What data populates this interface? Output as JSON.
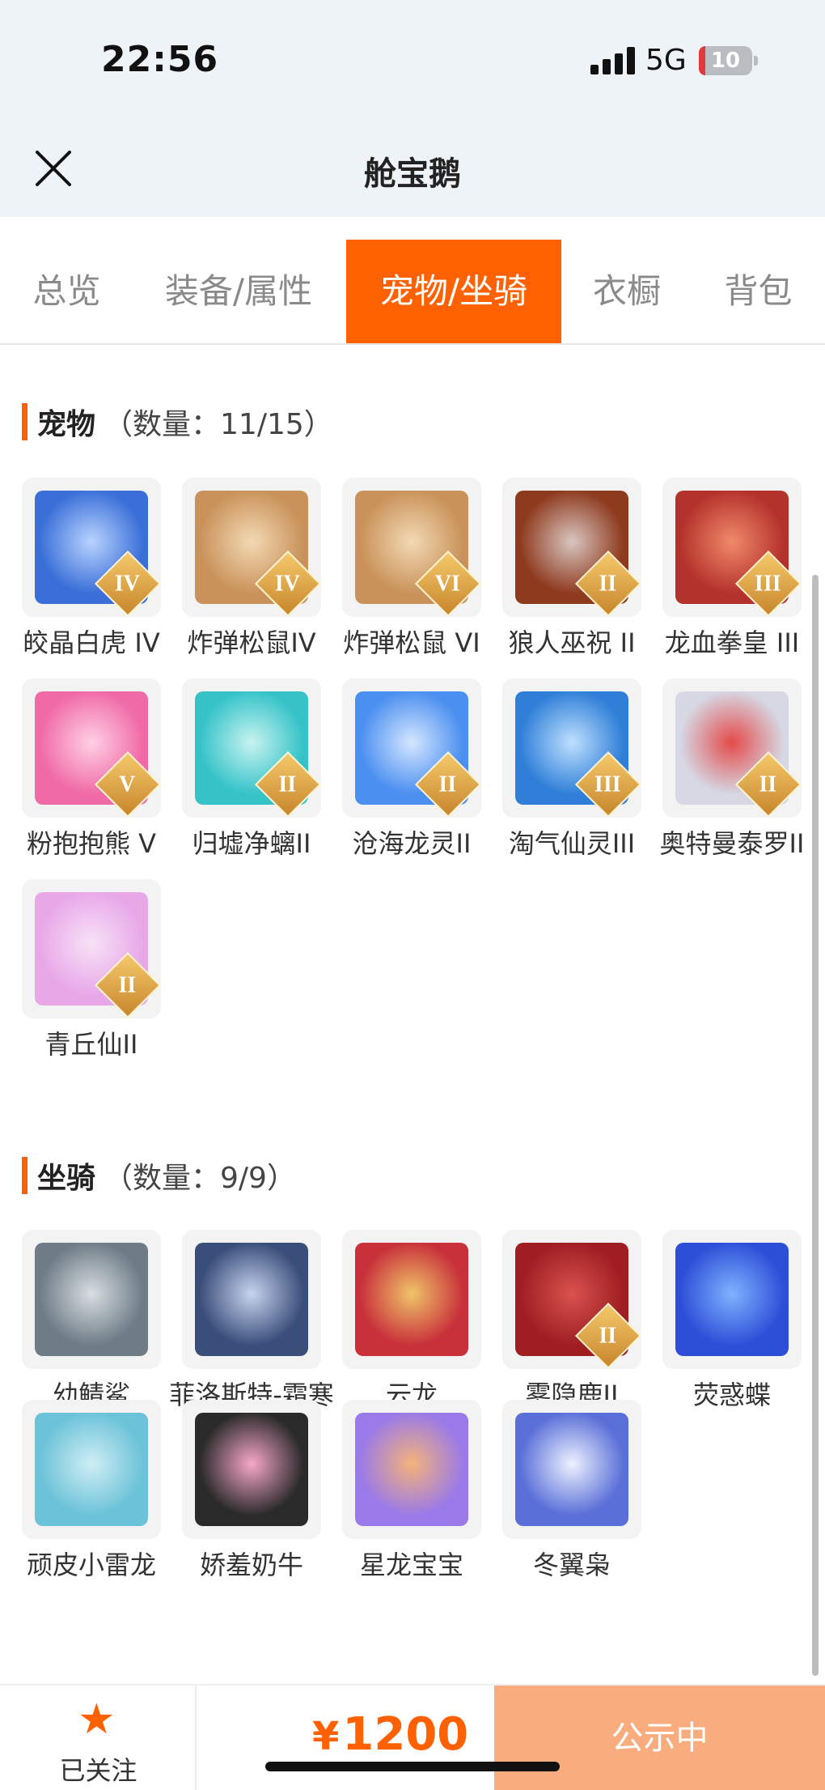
{
  "status_bar": {
    "time": "22:56",
    "network": "5G",
    "battery": "10"
  },
  "nav": {
    "title": "舱宝鹅"
  },
  "tabs": [
    {
      "label": "总览",
      "active": false
    },
    {
      "label": "装备/属性",
      "active": false
    },
    {
      "label": "宠物/坐骑",
      "active": true
    },
    {
      "label": "衣橱",
      "active": false
    },
    {
      "label": "背包",
      "active": false
    }
  ],
  "pets": {
    "title": "宠物",
    "count": "（数量：11/15）",
    "items": [
      {
        "name": "皎晶白虎 IV",
        "badge": "IV",
        "colors": [
          "#3a6fd8",
          "#b9d3ff"
        ]
      },
      {
        "name": "炸弹松鼠IV",
        "badge": "IV",
        "colors": [
          "#c9925a",
          "#f3d9b4"
        ]
      },
      {
        "name": "炸弹松鼠 VI",
        "badge": "VI",
        "colors": [
          "#c9925a",
          "#f3d9b4"
        ]
      },
      {
        "name": "狼人巫祝 II",
        "badge": "II",
        "colors": [
          "#8e3a1e",
          "#d9c6c0"
        ]
      },
      {
        "name": "龙血拳皇 III",
        "badge": "III",
        "colors": [
          "#b4322c",
          "#f08a6a"
        ]
      },
      {
        "name": "粉抱抱熊 V",
        "badge": "V",
        "colors": [
          "#f06aa6",
          "#ffd0e4"
        ]
      },
      {
        "name": "归墟净螭II",
        "badge": "II",
        "colors": [
          "#35c3c8",
          "#c8f3f1"
        ]
      },
      {
        "name": "沧海龙灵II",
        "badge": "II",
        "colors": [
          "#4b8ff0",
          "#d5e7ff"
        ]
      },
      {
        "name": "淘气仙灵III",
        "badge": "III",
        "colors": [
          "#2f7fd8",
          "#bfe0ff"
        ]
      },
      {
        "name": "奥特曼泰罗II",
        "badge": "II",
        "colors": [
          "#d6d8e4",
          "#e44a4a"
        ]
      },
      {
        "name": "青丘仙II",
        "badge": "II",
        "colors": [
          "#e8a8e8",
          "#f7e2f7"
        ]
      }
    ]
  },
  "mounts": {
    "title": "坐骑",
    "count": "（数量：9/9）",
    "items": [
      {
        "name": "幼鲭鲨",
        "badge": "",
        "colors": [
          "#6e7c86",
          "#d9dee2"
        ]
      },
      {
        "name": "菲洛斯特-霜寒",
        "badge": "",
        "colors": [
          "#3a4e7a",
          "#c8d4ee"
        ]
      },
      {
        "name": "云龙",
        "badge": "",
        "colors": [
          "#c8303a",
          "#f0c46a"
        ]
      },
      {
        "name": "雾隐鹿II",
        "badge": "II",
        "colors": [
          "#9e1e22",
          "#d9534f"
        ]
      },
      {
        "name": "荧惑蝶",
        "badge": "",
        "colors": [
          "#2d4fd8",
          "#7fb2ff"
        ]
      },
      {
        "name": "顽皮小雷龙",
        "badge": "",
        "colors": [
          "#6cc2d8",
          "#cfeef5"
        ]
      },
      {
        "name": "娇羞奶牛",
        "badge": "",
        "colors": [
          "#2a2a2a",
          "#f7a7c9"
        ]
      },
      {
        "name": "星龙宝宝",
        "badge": "",
        "colors": [
          "#9a7ae8",
          "#f4b27a"
        ]
      },
      {
        "name": "冬翼枭",
        "badge": "",
        "colors": [
          "#5a6fd8",
          "#eef2ff"
        ]
      }
    ]
  },
  "bottom": {
    "follow_label": "已关注",
    "currency": "¥",
    "price": "1200",
    "status_label": "公示中"
  }
}
